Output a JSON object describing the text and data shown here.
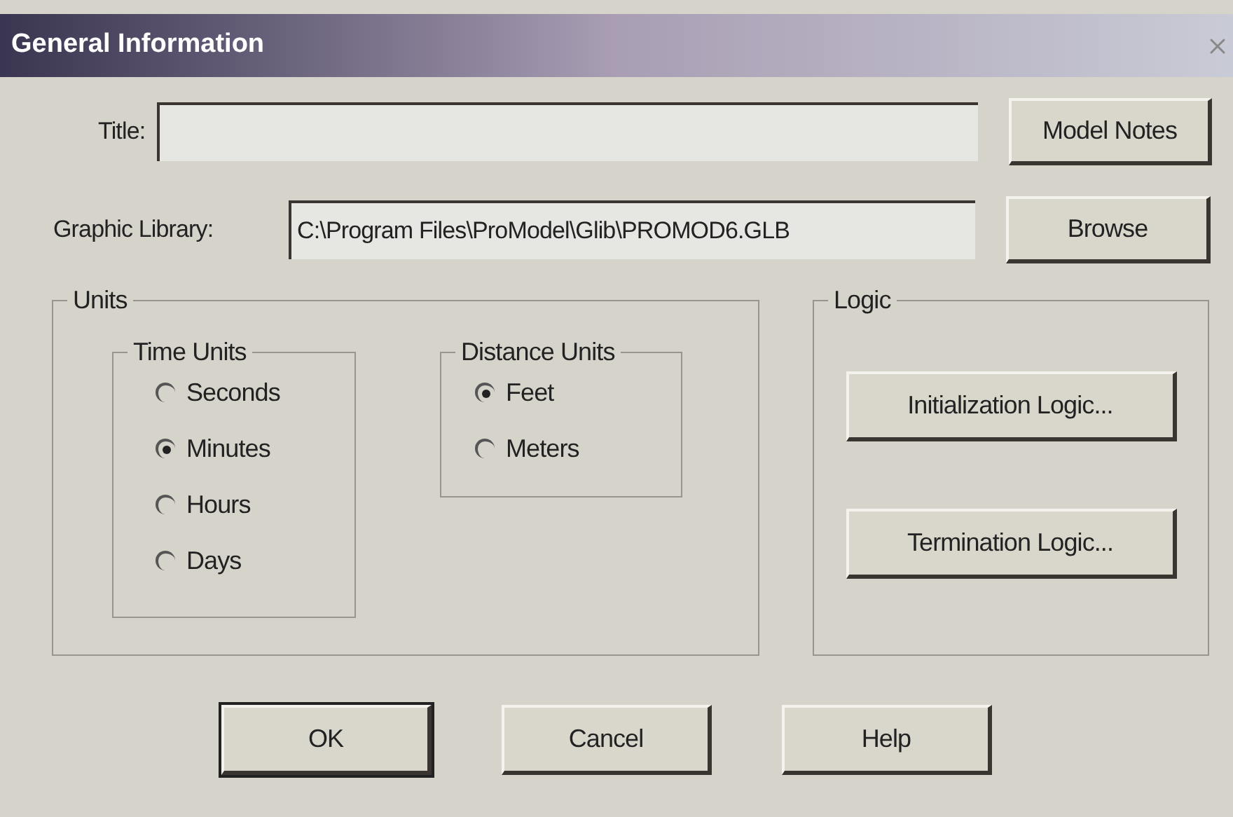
{
  "window": {
    "title": "General Information"
  },
  "title_field": {
    "label": "Title:"
  },
  "model_notes_button": "Model Notes",
  "graphic_library": {
    "label": "Graphic Library:",
    "value": "C:\\Program Files\\ProModel\\Glib\\PROMOD6.GLB"
  },
  "browse_button": "Browse",
  "units": {
    "title": "Units",
    "time_units": {
      "title": "Time Units",
      "options": [
        {
          "label": "Seconds",
          "selected": false
        },
        {
          "label": "Minutes",
          "selected": true
        },
        {
          "label": "Hours",
          "selected": false
        },
        {
          "label": "Days",
          "selected": false
        }
      ]
    },
    "distance_units": {
      "title": "Distance Units",
      "options": [
        {
          "label": "Feet",
          "selected": true
        },
        {
          "label": "Meters",
          "selected": false
        }
      ]
    }
  },
  "logic": {
    "title": "Logic",
    "buttons": [
      "Initialization Logic...",
      "Termination Logic..."
    ]
  },
  "buttons": [
    {
      "label": "OK",
      "default": true
    },
    {
      "label": "Cancel",
      "default": false
    },
    {
      "label": "Help",
      "default": false
    }
  ]
}
